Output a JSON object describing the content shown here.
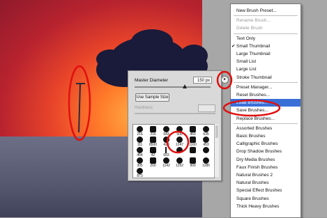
{
  "brush_panel": {
    "master_diameter_label": "Master Diameter",
    "diameter_value": "150 px",
    "use_sample_size_label": "Use Sample Size",
    "hardness_label": "Hardness:",
    "menu_arrow_glyph": "▸",
    "brushes": [
      {
        "num": "216"
      },
      {
        "num": "216"
      },
      {
        "num": "643"
      },
      {
        "num": "500"
      },
      {
        "num": "450"
      },
      {
        "num": "635"
      },
      {
        "num": "111"
      },
      {
        "num": "8500"
      },
      {
        "num": "420"
      },
      {
        "num": "1247"
      },
      {
        "num": "1160"
      },
      {
        "num": "453"
      },
      {
        "num": "464"
      },
      {
        "num": "42"
      },
      {
        "num": "603"
      },
      {
        "num": ""
      },
      {
        "num": ""
      },
      {
        "num": ""
      },
      {
        "num": "305"
      },
      {
        "num": "200"
      },
      {
        "num": "1142"
      },
      {
        "num": "1252"
      },
      {
        "num": "900"
      },
      {
        "num": "1285"
      },
      {
        "num": "873"
      }
    ]
  },
  "flyout_menu": {
    "items": [
      {
        "label": "New Brush Preset...",
        "state": "normal"
      },
      {
        "label": "Rename Brush...",
        "state": "disabled"
      },
      {
        "label": "Delete Brush",
        "state": "disabled"
      },
      {
        "label": "Text Only",
        "state": "normal"
      },
      {
        "label": "Small Thumbnail",
        "state": "checked"
      },
      {
        "label": "Large Thumbnail",
        "state": "normal"
      },
      {
        "label": "Small List",
        "state": "normal"
      },
      {
        "label": "Large List",
        "state": "normal"
      },
      {
        "label": "Stroke Thumbnail",
        "state": "normal"
      },
      {
        "label": "Preset Manager...",
        "state": "normal"
      },
      {
        "label": "Reset Brushes...",
        "state": "normal"
      },
      {
        "label": "Load Brushes...",
        "state": "highlighted"
      },
      {
        "label": "Save Brushes...",
        "state": "normal"
      },
      {
        "label": "Replace Brushes...",
        "state": "normal"
      },
      {
        "label": "Assorted Brushes",
        "state": "normal"
      },
      {
        "label": "Basic Brushes",
        "state": "normal"
      },
      {
        "label": "Calligraphic Brushes",
        "state": "normal"
      },
      {
        "label": "Drop Shadow Brushes",
        "state": "normal"
      },
      {
        "label": "Dry Media Brushes",
        "state": "normal"
      },
      {
        "label": "Faux Finish Brushes",
        "state": "normal"
      },
      {
        "label": "Natural Brushes 2",
        "state": "normal"
      },
      {
        "label": "Natural Brushes",
        "state": "normal"
      },
      {
        "label": "Special Effect Brushes",
        "state": "normal"
      },
      {
        "label": "Square Brushes",
        "state": "normal"
      },
      {
        "label": "Thick Heavy Brushes",
        "state": "normal"
      }
    ],
    "check_glyph": "✔"
  },
  "colors": {
    "highlight": "#3a6fd8",
    "annotation": "#e01010"
  }
}
